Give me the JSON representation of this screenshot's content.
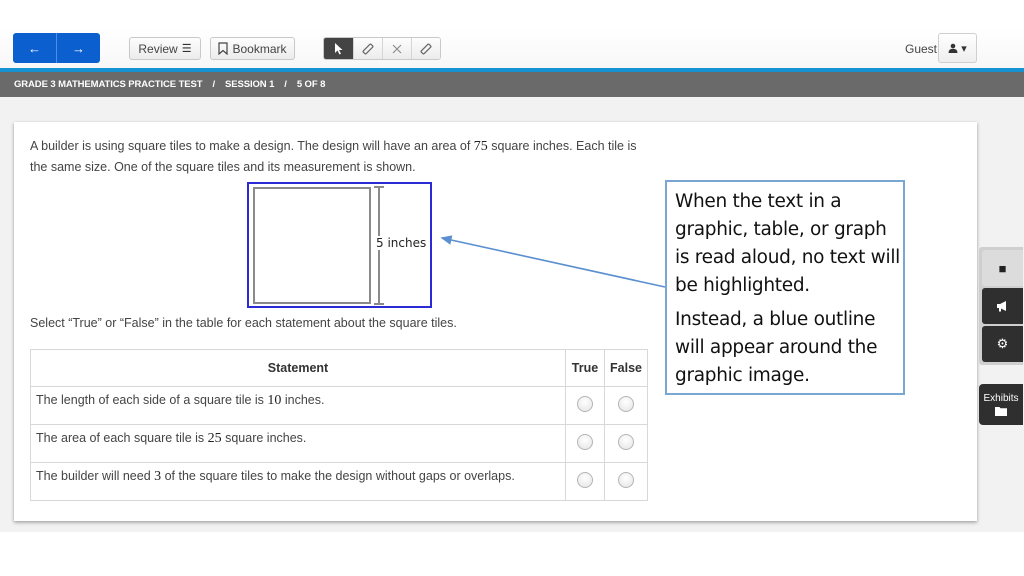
{
  "toolbar": {
    "back_icon": "←",
    "forward_icon": "→",
    "review_label": "Review",
    "review_icon": "☰",
    "bookmark_label": "Bookmark",
    "bookmark_icon": "⌑",
    "tools": [
      {
        "name": "pointer",
        "icon": "➤",
        "active": true
      },
      {
        "name": "highlighter",
        "icon": "✎",
        "active": false
      },
      {
        "name": "strikethrough",
        "icon": "✕",
        "active": false
      },
      {
        "name": "eraser",
        "icon": "✎",
        "active": false
      }
    ],
    "user_label": "Guest",
    "user_icon": "▲",
    "user_caret": "▾"
  },
  "breadcrumb": {
    "items": [
      "GRADE 3 MATHEMATICS PRACTICE TEST",
      "SESSION 1",
      "5 OF 8"
    ],
    "separator": "/"
  },
  "question": {
    "stem_part1": "A builder is using square tiles to make a design. The design will have an area of ",
    "stem_area": "75",
    "stem_part2": " square inches. Each tile is the same size. One of the square tiles and its measurement is shown.",
    "figure_label": "5 inches",
    "instruction": "Select “True” or “False” in the table for each statement about the square tiles.",
    "table": {
      "headers": [
        "Statement",
        "True",
        "False"
      ],
      "rows": [
        {
          "before": "The length of each side of a square tile is ",
          "number": "10",
          "after": " inches.",
          "selected": null
        },
        {
          "before": "The area of each square tile is ",
          "number": "25",
          "after": " square inches.",
          "selected": null
        },
        {
          "before": "The builder will need ",
          "number": "3",
          "after": " of the square tiles to make the design without gaps or overlaps.",
          "selected": null
        }
      ]
    }
  },
  "callout": {
    "paragraph1": "When the text in a graphic, table, or graph is read aloud, no text will be highlighted.",
    "paragraph2": "Instead, a blue outline will appear around the graphic image."
  },
  "side_tools": {
    "stop_icon": "■",
    "speak_icon": "📢",
    "settings_icon": "⚙",
    "exhibits_label": "Exhibits",
    "exhibits_icon": "▬"
  },
  "colors": {
    "nav_blue": "#0b5fcf",
    "accent_rule": "#1592d2",
    "breadcrumb_bg": "#6a6a6a",
    "graphic_outline": "#2b2bd6",
    "callout_border": "#7aa6d4"
  }
}
